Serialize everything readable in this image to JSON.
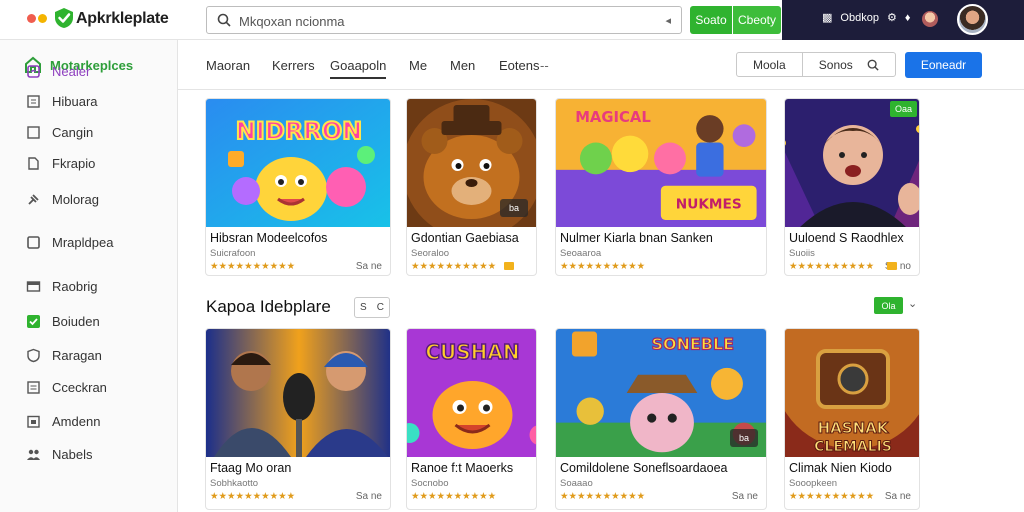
{
  "app": {
    "brand": "Apkrkleplate",
    "dots": [
      "#f05d4f",
      "#f4b400",
      "#2fb32f"
    ]
  },
  "topbar": {
    "search_value": "Mkqoxan ncionma",
    "btn_primary": "Soato",
    "btn_secondary": "Cbeoty",
    "right_label": "Obdkop",
    "right_icons": [
      "grid-icon",
      "settings-icon",
      "bell-icon"
    ]
  },
  "sidebar": {
    "header": "Motarkeplces",
    "items": [
      {
        "label": "Nealer",
        "icon": "tag-icon",
        "active": true
      },
      {
        "label": "Hibuara",
        "icon": "document-icon"
      },
      {
        "label": "Cangin",
        "icon": "box-icon"
      },
      {
        "label": "Fkrapio",
        "icon": "file-icon"
      },
      {
        "label": "Molorag",
        "icon": "gavel-icon"
      },
      {
        "label": "Mrapldpea",
        "icon": "square-icon"
      },
      {
        "label": "Raobrig",
        "icon": "card-icon"
      },
      {
        "label": "Boiuden",
        "icon": "check-icon"
      },
      {
        "label": "Raragan",
        "icon": "shield-icon"
      },
      {
        "label": "Cceckran",
        "icon": "list-icon"
      },
      {
        "label": "Amdenn",
        "icon": "calendar-icon"
      },
      {
        "label": "Nabels",
        "icon": "group-icon"
      }
    ]
  },
  "nav": {
    "tabs": [
      "Maoran",
      "Kerrers",
      "Goaapoln",
      "Me",
      "Men",
      "Eotens"
    ],
    "tabs_more": "--",
    "active_tab": "Goaapoln",
    "seg_left": "Moola",
    "seg_right": "Sonos",
    "cta": "Eoneadr"
  },
  "section": {
    "title": "Kapoa Idebplare",
    "ctrl_left": "S",
    "ctrl_right": "C",
    "badge": "Ola"
  },
  "cards": [
    {
      "title": "Hibsran Modeelcofos",
      "sub": "Suicrafoon",
      "rating": "★★★★★★★★★★",
      "price": "Sa ne",
      "art": "candy",
      "badge": ""
    },
    {
      "title": "Gdontian Gaebiasa",
      "sub": "Seoraloo",
      "rating": "★★★★★★★★★★",
      "price": "",
      "art": "bear",
      "badge": "ba"
    },
    {
      "title": "Nulmer Kiarla bnan Sanken",
      "sub": "Seoaaroa",
      "rating": "★★★★★★★★★★",
      "price": "",
      "art": "party",
      "badge": ""
    },
    {
      "title": "Uuloend S Raodhlex",
      "sub": "Suoiis",
      "rating": "★★★★★★★★★★",
      "price": "Sa no",
      "art": "kid",
      "badge": "Oaa"
    },
    {
      "title": "Ftaag Mo oran",
      "sub": "Sobhkaotto",
      "rating": "★★★★★★★★★★",
      "price": "Sa ne",
      "art": "mic",
      "badge": ""
    },
    {
      "title": "Ranoe f:t Maoerks",
      "sub": "Socnobo",
      "rating": "★★★★★★★★★★",
      "price": "",
      "art": "sun",
      "badge": ""
    },
    {
      "title": "Comildolene Soneflsoardaoea",
      "sub": "Soaaao",
      "rating": "★★★★★★★★★★",
      "price": "Sa ne",
      "art": "adventure",
      "badge": "ba"
    },
    {
      "title": "Climak Nien Kiodo",
      "sub": "Sooopkeen",
      "rating": "★★★★★★★★★★",
      "price": "Sa ne",
      "art": "chest",
      "badge": ""
    }
  ]
}
